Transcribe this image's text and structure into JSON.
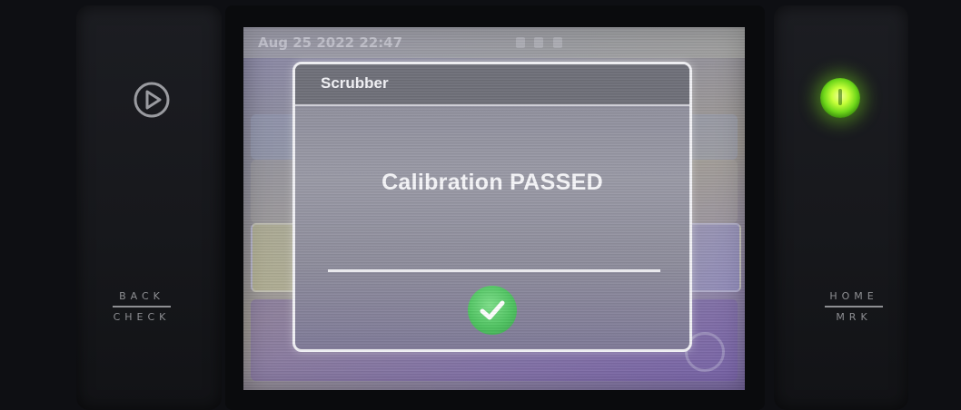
{
  "status_bar": {
    "datetime": "Aug 25 2022 22:47"
  },
  "dialog": {
    "title": "Scrubber",
    "message": "Calibration PASSED",
    "confirm_icon": "check-icon"
  },
  "hardware_keys": {
    "left": {
      "icon": "play-icon",
      "label_top": "BACK",
      "label_bottom": "CHECK"
    },
    "right": {
      "icon": "power-led",
      "label_top": "HOME",
      "label_bottom": "MRK"
    }
  },
  "colors": {
    "led": "#8fe632",
    "check_button": "#4fc461",
    "dialog_border": "#f2f2f6"
  }
}
